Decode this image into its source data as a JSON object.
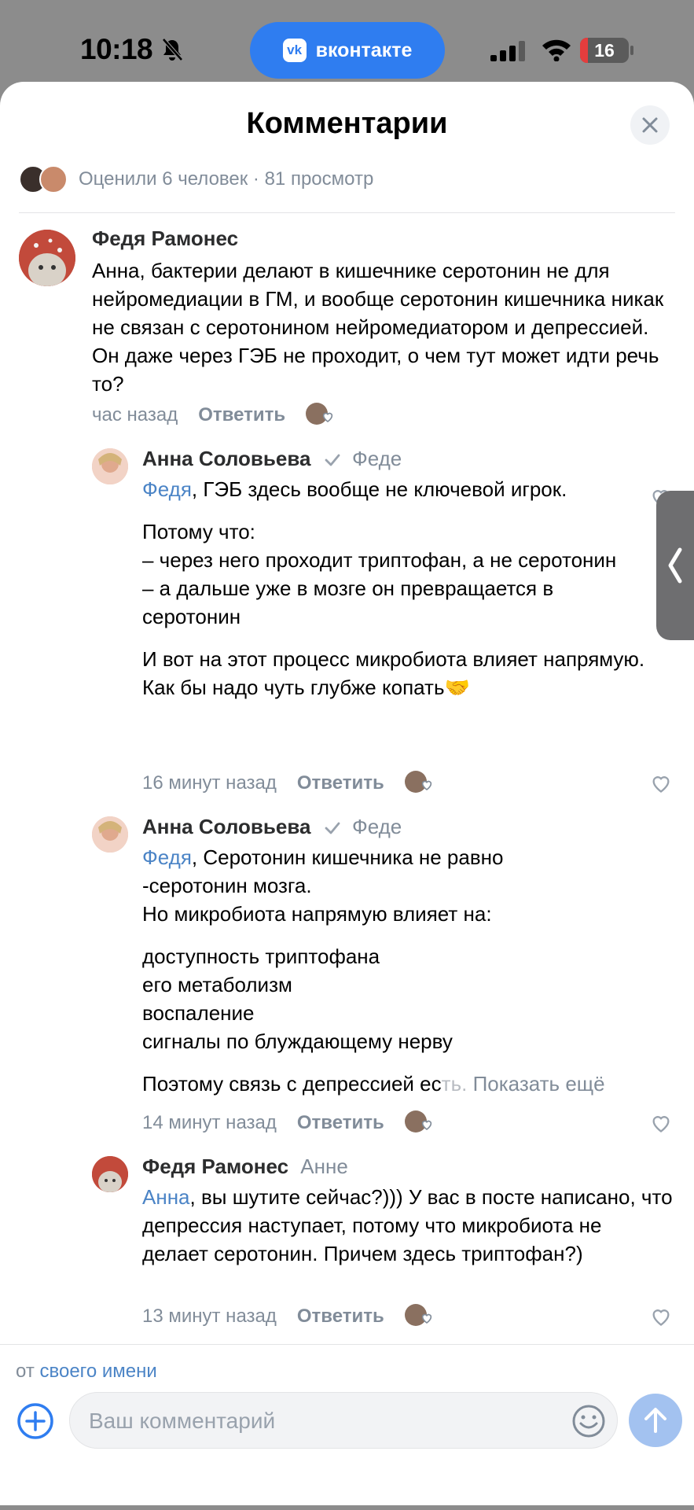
{
  "status_bar": {
    "time": "10:18",
    "app_name": "вконтакте",
    "app_logo": "vk",
    "battery": "16",
    "battery_level": 0.16,
    "battery_color": "#e53d3d",
    "icons": [
      "bell-off-icon",
      "signal-icon",
      "wifi-icon",
      "battery-icon"
    ]
  },
  "header": {
    "title": "Комментарии",
    "close_icon": "close-icon"
  },
  "stats": {
    "text": "Оценили 6 человек · 81 просмотр"
  },
  "comments": [
    {
      "author": "Федя Рамонес",
      "reply_to": "",
      "mention": "",
      "paragraphs": [
        "Анна, бактерии делают в кишечнике серотонин не для нейромедиации в ГМ, и вообще серотонин кишечника никак не связан с серотонином нейромедиатором и депрессией. Он даже через ГЭБ не проходит, о чем тут может идти речь то?"
      ],
      "time": "час назад",
      "reply_label": "Ответить"
    },
    {
      "author": "Анна Соловьева",
      "reply_to": "Феде",
      "mention": "Федя",
      "first_line": ", ГЭБ здесь вообще не ключевой игрок.",
      "paragraphs": [
        "Потому что:\n– через него проходит триптофан, а не серотонин\n– а дальше уже в мозге он превращается в серотонин",
        "И вот на этот процесс микробиота влияет напрямую.\nКак бы надо чуть глубже копать🤝"
      ],
      "time": "16 минут назад",
      "reply_label": "Ответить"
    },
    {
      "author": "Анна Соловьева",
      "reply_to": "Феде",
      "mention": "Федя",
      "first_line": ", Серотонин кишечника не равно\n-серотонин мозга.\nНо микробиота напрямую влияет на:",
      "paragraphs": [
        "доступность триптофана\nего метаболизм\nвоспаление\nсигналы по блуждающему нерву"
      ],
      "last_line": "Поэтому связь с депрессией ес",
      "last_line_fade": "ть.",
      "show_more": "Показать ещё",
      "time": "14 минут назад",
      "reply_label": "Ответить"
    },
    {
      "author": "Федя Рамонес",
      "reply_to": "Анне",
      "mention": "Анна",
      "first_line": ", вы шутите сейчас?))) У вас в посте написано, что депрессия наступает, потому что микробиота не делает серотонин. Причем здесь триптофан?)",
      "time": "13 минут назад",
      "reply_label": "Ответить"
    }
  ],
  "composer": {
    "from_prefix": "от",
    "from_link": "своего имени",
    "placeholder": "Ваш комментарий",
    "add_icon": "plus-circle-icon",
    "emoji_icon": "smile-icon",
    "send_icon": "arrow-up-icon"
  },
  "colors": {
    "accent": "#2f7df0",
    "link": "#4b84c6",
    "muted": "#818c99",
    "send_disabled": "#a3c2f0"
  }
}
